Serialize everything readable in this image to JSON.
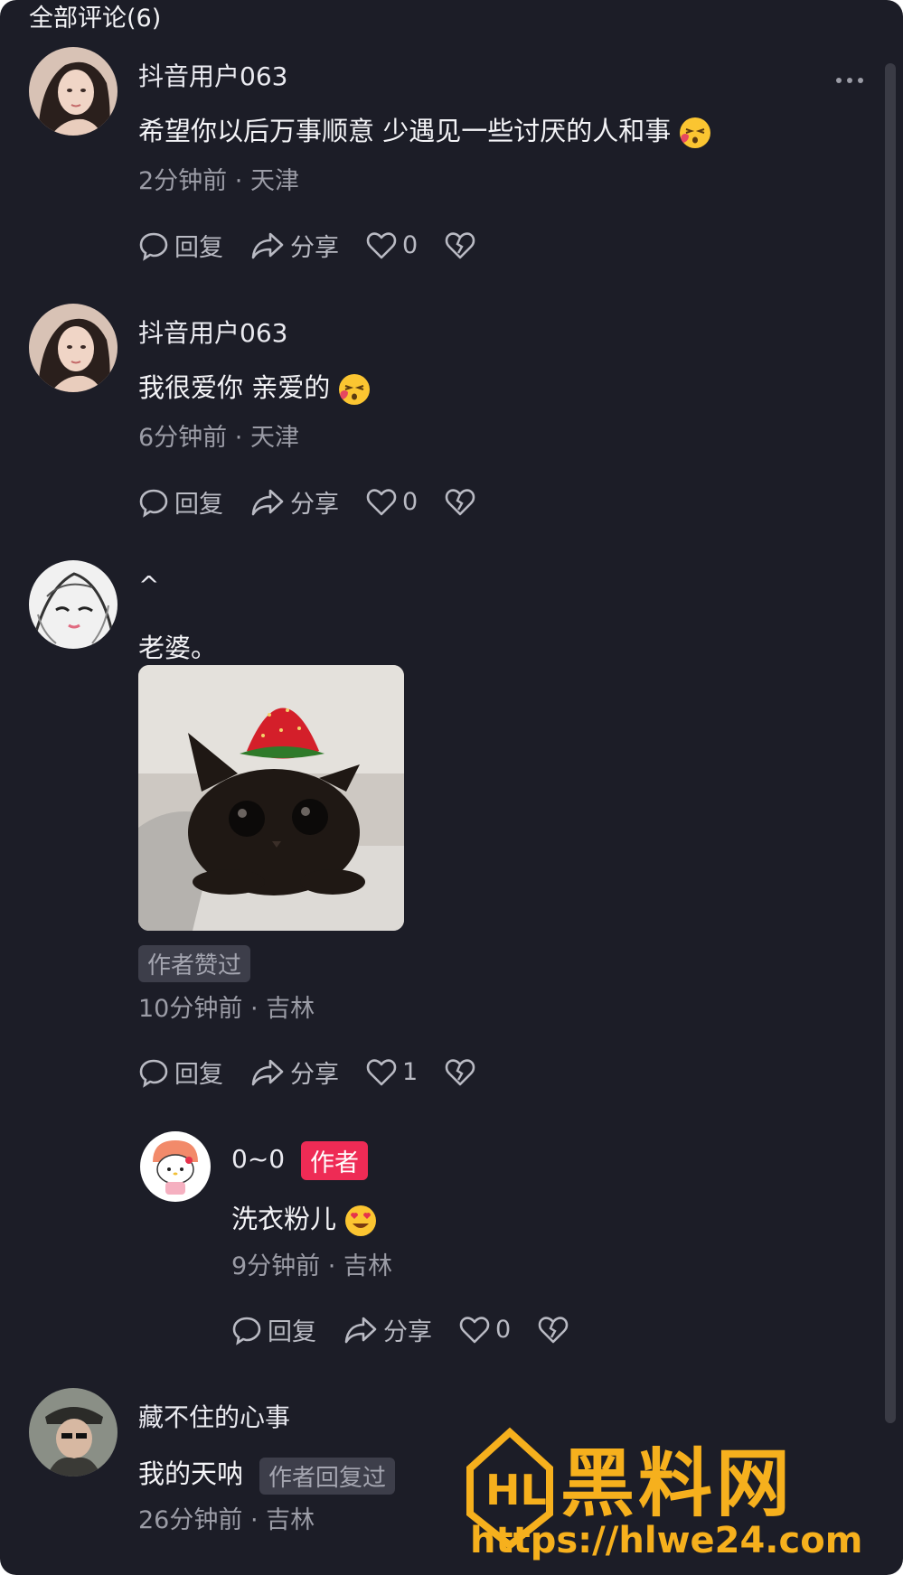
{
  "header": {
    "title": "全部评论(6)"
  },
  "comments": [
    {
      "username": "抖音用户063",
      "text": "希望你以后万事顺意 少遇见一些讨厌的人和事",
      "emoji": "kiss-wink-emoji",
      "time": "2分钟前",
      "location": "天津",
      "reply_label": "回复",
      "share_label": "分享",
      "likes": "0"
    },
    {
      "username": "抖音用户063",
      "text": "我很爱你 亲爱的",
      "emoji": "kiss-wink-emoji",
      "time": "6分钟前",
      "location": "天津",
      "reply_label": "回复",
      "share_label": "分享",
      "likes": "0"
    },
    {
      "username": "^",
      "text": "老婆。",
      "image": "black-cat-with-strawberry-photo",
      "badge": "作者赞过",
      "time": "10分钟前",
      "location": "吉林",
      "reply_label": "回复",
      "share_label": "分享",
      "likes": "1"
    },
    {
      "username": "藏不住的心事",
      "text": "我的天呐",
      "badge": "作者回复过",
      "time": "26分钟前",
      "location": "吉林"
    }
  ],
  "reply": {
    "username": "0~0",
    "author_badge": "作者",
    "text": "洗衣粉儿",
    "emoji": "heart-eyes-emoji",
    "time": "9分钟前",
    "location": "吉林",
    "reply_label": "回复",
    "share_label": "分享",
    "likes": "0"
  },
  "separator": "·",
  "watermark": {
    "brand": "黑料网",
    "url": "https://hlwe24.com",
    "logo": "HL"
  },
  "colors": {
    "background": "#1c1d27",
    "author_badge": "#ee2b55",
    "watermark": "#f6b01d"
  }
}
